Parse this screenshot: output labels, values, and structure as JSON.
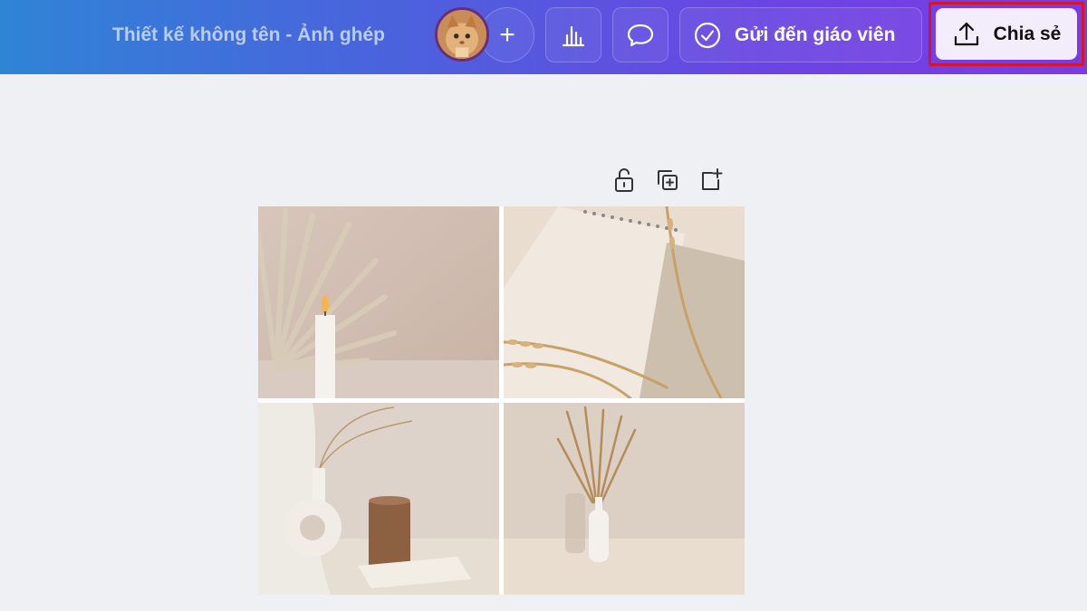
{
  "header": {
    "document_title": "Thiết kế không tên - Ảnh ghép",
    "add_label": "+",
    "send_to_teacher_label": "Gửi đến giáo viên",
    "share_label": "Chia sẻ"
  },
  "colors": {
    "header_gradient_start": "#2f84d6",
    "header_gradient_end": "#7c3ae4",
    "share_button_bg": "#f2ecfb",
    "highlight_border": "#d5162a",
    "canvas_bg": "#eef0f4"
  },
  "icons": {
    "stats": "bar-chart-icon",
    "comment": "speech-bubble-icon",
    "send": "check-circle-icon",
    "share": "upload-icon",
    "lock": "unlock-icon",
    "duplicate": "duplicate-page-icon",
    "add_page": "add-page-icon"
  },
  "collage": {
    "tiles": [
      {
        "subject": "candle-and-dried-palm"
      },
      {
        "subject": "notebook-and-dried-grass"
      },
      {
        "subject": "ring-vase-and-candle"
      },
      {
        "subject": "pampas-in-vases"
      }
    ]
  }
}
